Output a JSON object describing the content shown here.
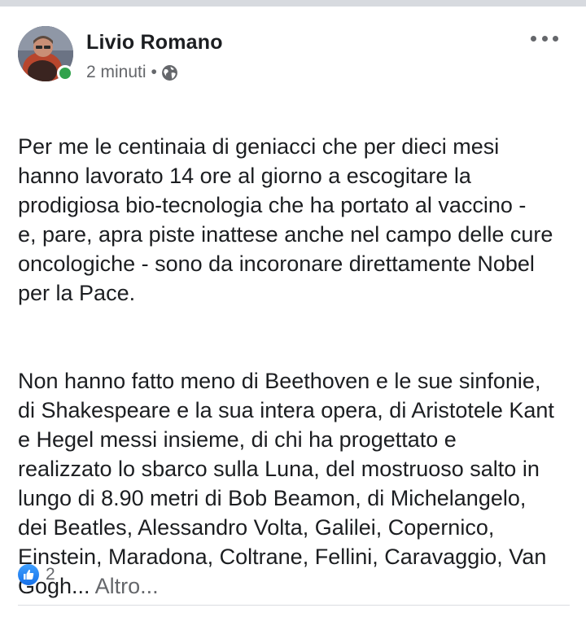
{
  "post": {
    "author": "Livio Romano",
    "timestamp": "2 minuti",
    "separator": "•",
    "audience_icon": "globe-icon",
    "more_icon": "more-options-icon",
    "paragraph_1": "Per me le centinaia di geniacci che per dieci mesi\nhanno lavorato 14 ore al giorno a escogitare la\nprodigiosa bio-tecnologia che ha portato al vaccino -\ne, pare, apra piste inattese anche nel campo delle cure\noncologiche - sono da incoronare direttamente Nobel\nper la Pace.",
    "paragraph_2": "Non hanno fatto meno di Beethoven e le sue sinfonie,\ndi Shakespeare e la sua intera opera, di Aristotele Kant\ne Hegel messi insieme, di chi ha progettato e\nrealizzato lo sbarco sulla Luna, del mostruoso salto in\nlungo di 8.90 metri di Bob Beamon, di Michelangelo,\ndei Beatles, Alessandro Volta, Galilei, Copernico,\nEinstein, Maradona, Coltrane, Fellini, Caravaggio, Van\nGogh...",
    "see_more": "Altro...",
    "reaction_icon": "like-icon",
    "reaction_count": "2"
  },
  "colors": {
    "text": "#1c1e21",
    "secondary_text": "#65676b",
    "like_blue": "#1877f2",
    "online_green": "#31a24c",
    "divider": "#dadde1"
  }
}
